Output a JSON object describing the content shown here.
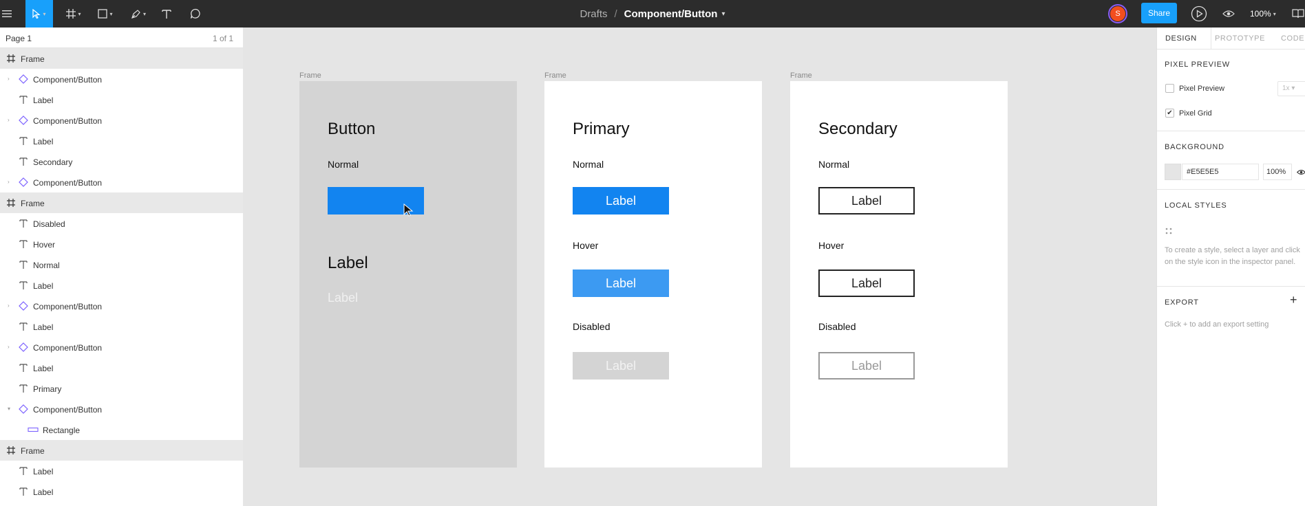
{
  "topbar": {
    "breadcrumb_root": "Drafts",
    "breadcrumb_sep": "/",
    "file_name": "Component/Button",
    "avatar_initial": "S",
    "share_label": "Share",
    "zoom_label": "100%"
  },
  "layers": {
    "page_name": "Page 1",
    "page_count": "1 of 1",
    "items": [
      {
        "label": "Frame",
        "type": "frame"
      },
      {
        "label": "Component/Button",
        "type": "component"
      },
      {
        "label": "Label",
        "type": "text"
      },
      {
        "label": "Component/Button",
        "type": "component"
      },
      {
        "label": "Label",
        "type": "text"
      },
      {
        "label": "Secondary",
        "type": "text"
      },
      {
        "label": "Component/Button",
        "type": "component"
      },
      {
        "label": "Frame",
        "type": "frame"
      },
      {
        "label": "Disabled",
        "type": "text"
      },
      {
        "label": "Hover",
        "type": "text"
      },
      {
        "label": "Normal",
        "type": "text"
      },
      {
        "label": "Label",
        "type": "text"
      },
      {
        "label": "Component/Button",
        "type": "component"
      },
      {
        "label": "Label",
        "type": "text"
      },
      {
        "label": "Component/Button",
        "type": "component"
      },
      {
        "label": "Label",
        "type": "text"
      },
      {
        "label": "Primary",
        "type": "text"
      },
      {
        "label": "Component/Button",
        "type": "component-open"
      },
      {
        "label": "Rectangle",
        "type": "rect"
      },
      {
        "label": "Frame",
        "type": "frame"
      },
      {
        "label": "Label",
        "type": "text"
      },
      {
        "label": "Label",
        "type": "text"
      }
    ]
  },
  "canvas": {
    "frame_label": "Frame",
    "frame1": {
      "title": "Button",
      "state": "Normal",
      "big_label": "Label",
      "light_label": "Label"
    },
    "frame2": {
      "title": "Primary",
      "normal": "Normal",
      "hover": "Hover",
      "disabled": "Disabled",
      "button_label": "Label"
    },
    "frame3": {
      "title": "Secondary",
      "normal": "Normal",
      "hover": "Hover",
      "disabled": "Disabled",
      "button_label": "Label"
    }
  },
  "inspector": {
    "tabs": [
      "DESIGN",
      "PROTOTYPE",
      "CODE"
    ],
    "pixel_preview_heading": "PIXEL PREVIEW",
    "pixel_preview_label": "Pixel Preview",
    "pixel_preview_scale": "1x",
    "pixel_grid_label": "Pixel Grid",
    "background_heading": "BACKGROUND",
    "background_hex": "#E5E5E5",
    "background_opacity": "100%",
    "local_styles_heading": "LOCAL STYLES",
    "local_styles_help": "To create a style, select a layer and click on the style icon in the inspector panel.",
    "export_heading": "EXPORT",
    "export_help": "Click + to add an export setting"
  },
  "colors": {
    "toolbar_bg": "#2c2c2c",
    "accent": "#18a0fb",
    "primary_button": "#1284f0",
    "primary_hover": "#3c9af2",
    "disabled_button": "#d4d4d4",
    "canvas_bg": "#e5e5e5",
    "avatar": "#f24e1e"
  }
}
